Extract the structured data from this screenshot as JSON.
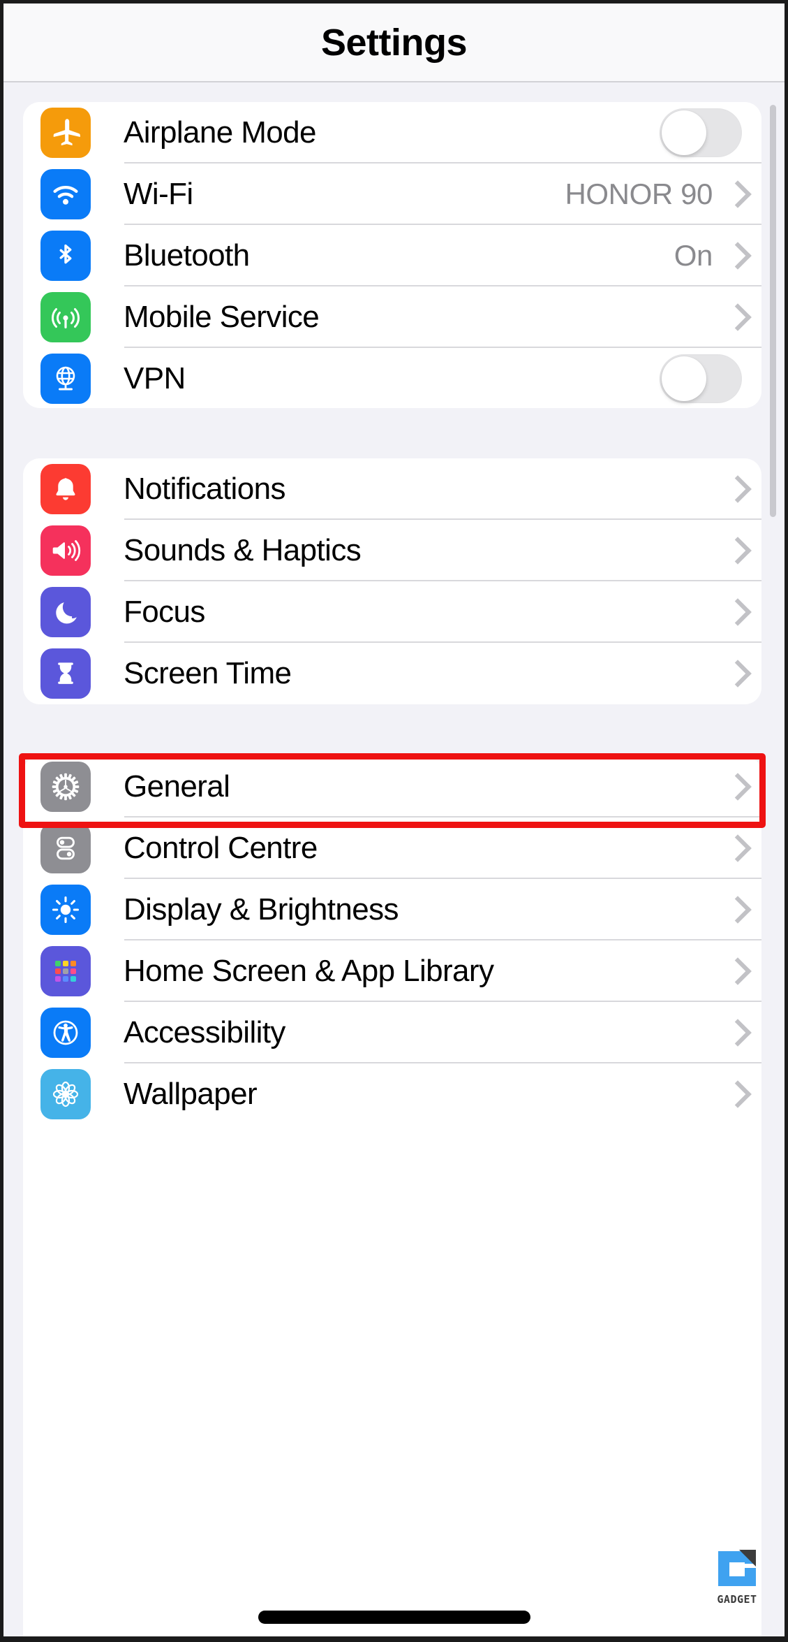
{
  "header": {
    "title": "Settings"
  },
  "groups": [
    {
      "id": "group-1",
      "rows": [
        {
          "label": "Airplane Mode",
          "icon": "airplane-icon",
          "icon_color": "#F59B0B",
          "accessory": "toggle",
          "toggle_state": "off",
          "value": ""
        },
        {
          "label": "Wi-Fi",
          "icon": "wifi-icon",
          "icon_color": "#0A7BF7",
          "accessory": "chevron",
          "value": "HONOR 90"
        },
        {
          "label": "Bluetooth",
          "icon": "bluetooth-icon",
          "icon_color": "#0A7BF7",
          "accessory": "chevron",
          "value": "On"
        },
        {
          "label": "Mobile Service",
          "icon": "antenna-icon",
          "icon_color": "#34C759",
          "accessory": "chevron",
          "value": ""
        },
        {
          "label": "VPN",
          "icon": "globe-icon",
          "icon_color": "#0A7BF7",
          "accessory": "toggle",
          "toggle_state": "off",
          "value": ""
        }
      ]
    },
    {
      "id": "group-2",
      "rows": [
        {
          "label": "Notifications",
          "icon": "bell-icon",
          "icon_color": "#FC3B32",
          "accessory": "chevron",
          "value": ""
        },
        {
          "label": "Sounds & Haptics",
          "icon": "speaker-icon",
          "icon_color": "#F5315C",
          "accessory": "chevron",
          "value": ""
        },
        {
          "label": "Focus",
          "icon": "moon-icon",
          "icon_color": "#5B57DB",
          "accessory": "chevron",
          "value": ""
        },
        {
          "label": "Screen Time",
          "icon": "hourglass-icon",
          "icon_color": "#5B57DB",
          "accessory": "chevron",
          "value": ""
        }
      ]
    },
    {
      "id": "group-3",
      "rows": [
        {
          "label": "General",
          "icon": "gear-icon",
          "icon_color": "#8E8E93",
          "accessory": "chevron",
          "value": "",
          "highlighted": true
        },
        {
          "label": "Control Centre",
          "icon": "sliders-icon",
          "icon_color": "#8E8E93",
          "accessory": "chevron",
          "value": ""
        },
        {
          "label": "Display & Brightness",
          "icon": "brightness-icon",
          "icon_color": "#0A7BF7",
          "accessory": "chevron",
          "value": ""
        },
        {
          "label": "Home Screen & App Library",
          "icon": "app-grid-icon",
          "icon_color": "#5B57DB",
          "accessory": "chevron",
          "value": ""
        },
        {
          "label": "Accessibility",
          "icon": "accessibility-icon",
          "icon_color": "#0A7BF7",
          "accessory": "chevron",
          "value": ""
        },
        {
          "label": "Wallpaper",
          "icon": "flower-icon",
          "icon_color": "#45B3E8",
          "accessory": "chevron",
          "value": ""
        }
      ]
    }
  ],
  "annotation": {
    "target": "General",
    "color": "#EE1212"
  },
  "watermark": {
    "text": "GADGET",
    "primary_color": "#3FA2F0",
    "secondary_color": "#3C3C3C"
  },
  "colors": {
    "page_background": "#F2F2F7",
    "card_background": "#FFFFFF",
    "header_background": "#F9F9FA",
    "separator": "#D8D8DC",
    "secondary_text": "#8A8A8E",
    "chevron": "#C2C2C6",
    "toggle_off_track": "#E5E5E7"
  }
}
